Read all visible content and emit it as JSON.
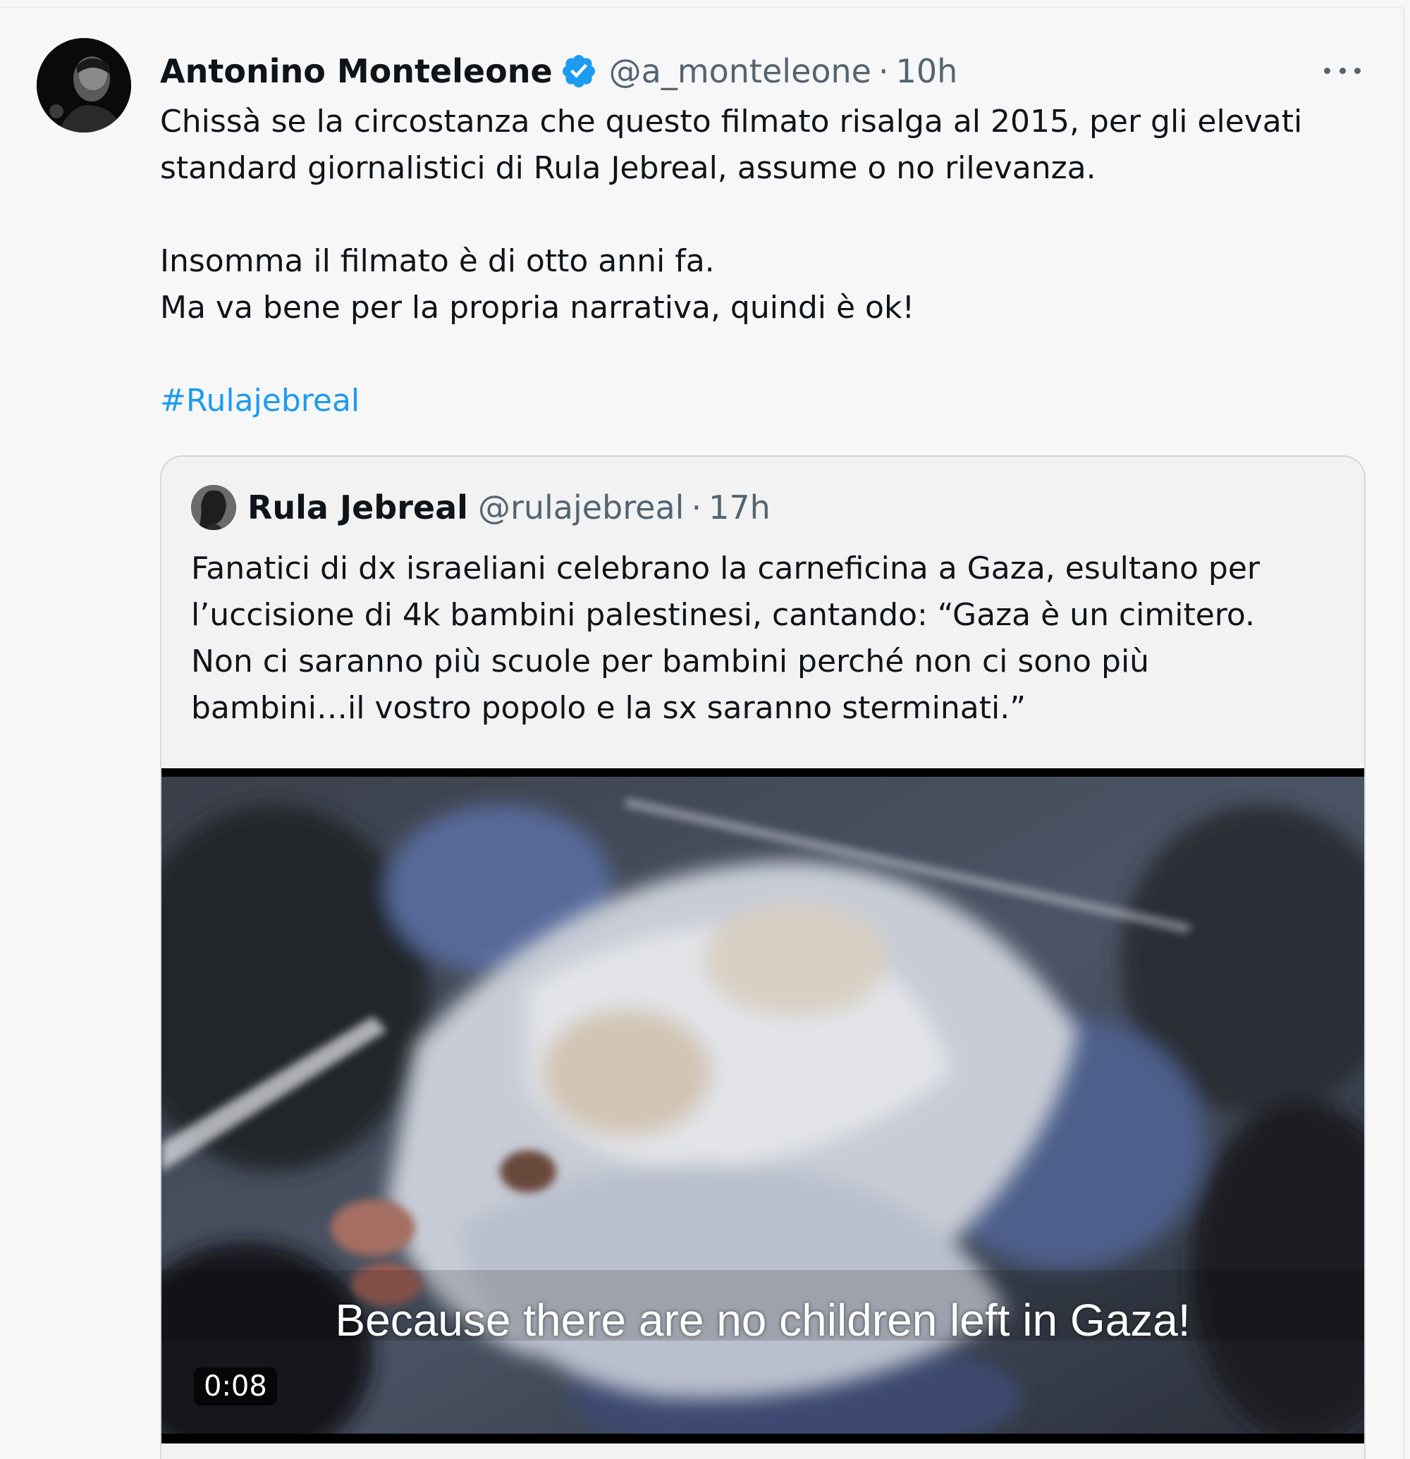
{
  "tweet": {
    "display_name": "Antonino Monteleone",
    "handle": "@a_monteleone",
    "separator": "·",
    "time": "10h",
    "text_lines": [
      "Chissà se la circostanza che questo filmato risalga al 2015, per gli elevati",
      "standard giornalistici di Rula Jebreal, assume o no rilevanza.",
      "Insomma il filmato è di otto anni fa.",
      "Ma va bene per la propria narrativa, quindi è ok!"
    ],
    "hashtag": "#Rulajebreal",
    "verified_badge_color": "#1d9bf0",
    "more_icon": "more-horizontal-icon"
  },
  "quote": {
    "display_name": "Rula Jebreal",
    "handle": "@rulajebreal",
    "separator": "·",
    "time": "17h",
    "text_lines": [
      "Fanatici di dx israeliani celebrano la carneficina a Gaza, esultano per",
      "l’uccisione di 4k bambini palestinesi, cantando: “Gaza è un cimitero.",
      "Non ci saranno più scuole per bambini perché non ci sono più",
      "bambini…il vostro popolo e la sx saranno sterminati.”"
    ],
    "video": {
      "subtitle": "Because there are no children left in Gaza!",
      "duration": "0:08"
    }
  },
  "colors": {
    "background": "#f7f7f7",
    "text": "#0f1419",
    "secondary": "#536471",
    "link": "#1d9bf0",
    "border": "#cfd9de"
  }
}
